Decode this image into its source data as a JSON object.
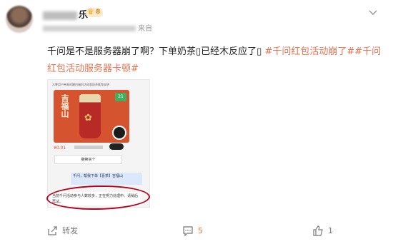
{
  "post": {
    "username_tail": "乐",
    "vip_label": "8",
    "meta_tail": "来自",
    "content": "千问是不是服务器崩了啊？下单奶茶▯已经木反应了▯ ",
    "tags": [
      "#千问红包活动崩了#",
      "#千问红包活动服务器卡顿#"
    ],
    "colors": {
      "link": "#eb7350",
      "accent": "#f07b36",
      "annotation": "#b3001b"
    }
  },
  "embedded_screenshot": {
    "header_text": "众筹用户带来的醒目福利活动和奶茶推荐说明",
    "promo_title": "吉福山",
    "promo_badge": "21",
    "price": "¥0.01",
    "button_label": "继续买个",
    "chat_message": "千问，帮我下单【喜茶】吉福山",
    "answer_text": "当前千问活动参与人数较多，正在努力处理中。请稍后再试。"
  },
  "actions": {
    "share_label": "转发",
    "comment_count": "5",
    "like_count": "1"
  },
  "icons": [
    "avatar",
    "vip-crown-icon",
    "chevron-down-icon",
    "share-icon",
    "comment-icon",
    "like-icon"
  ]
}
